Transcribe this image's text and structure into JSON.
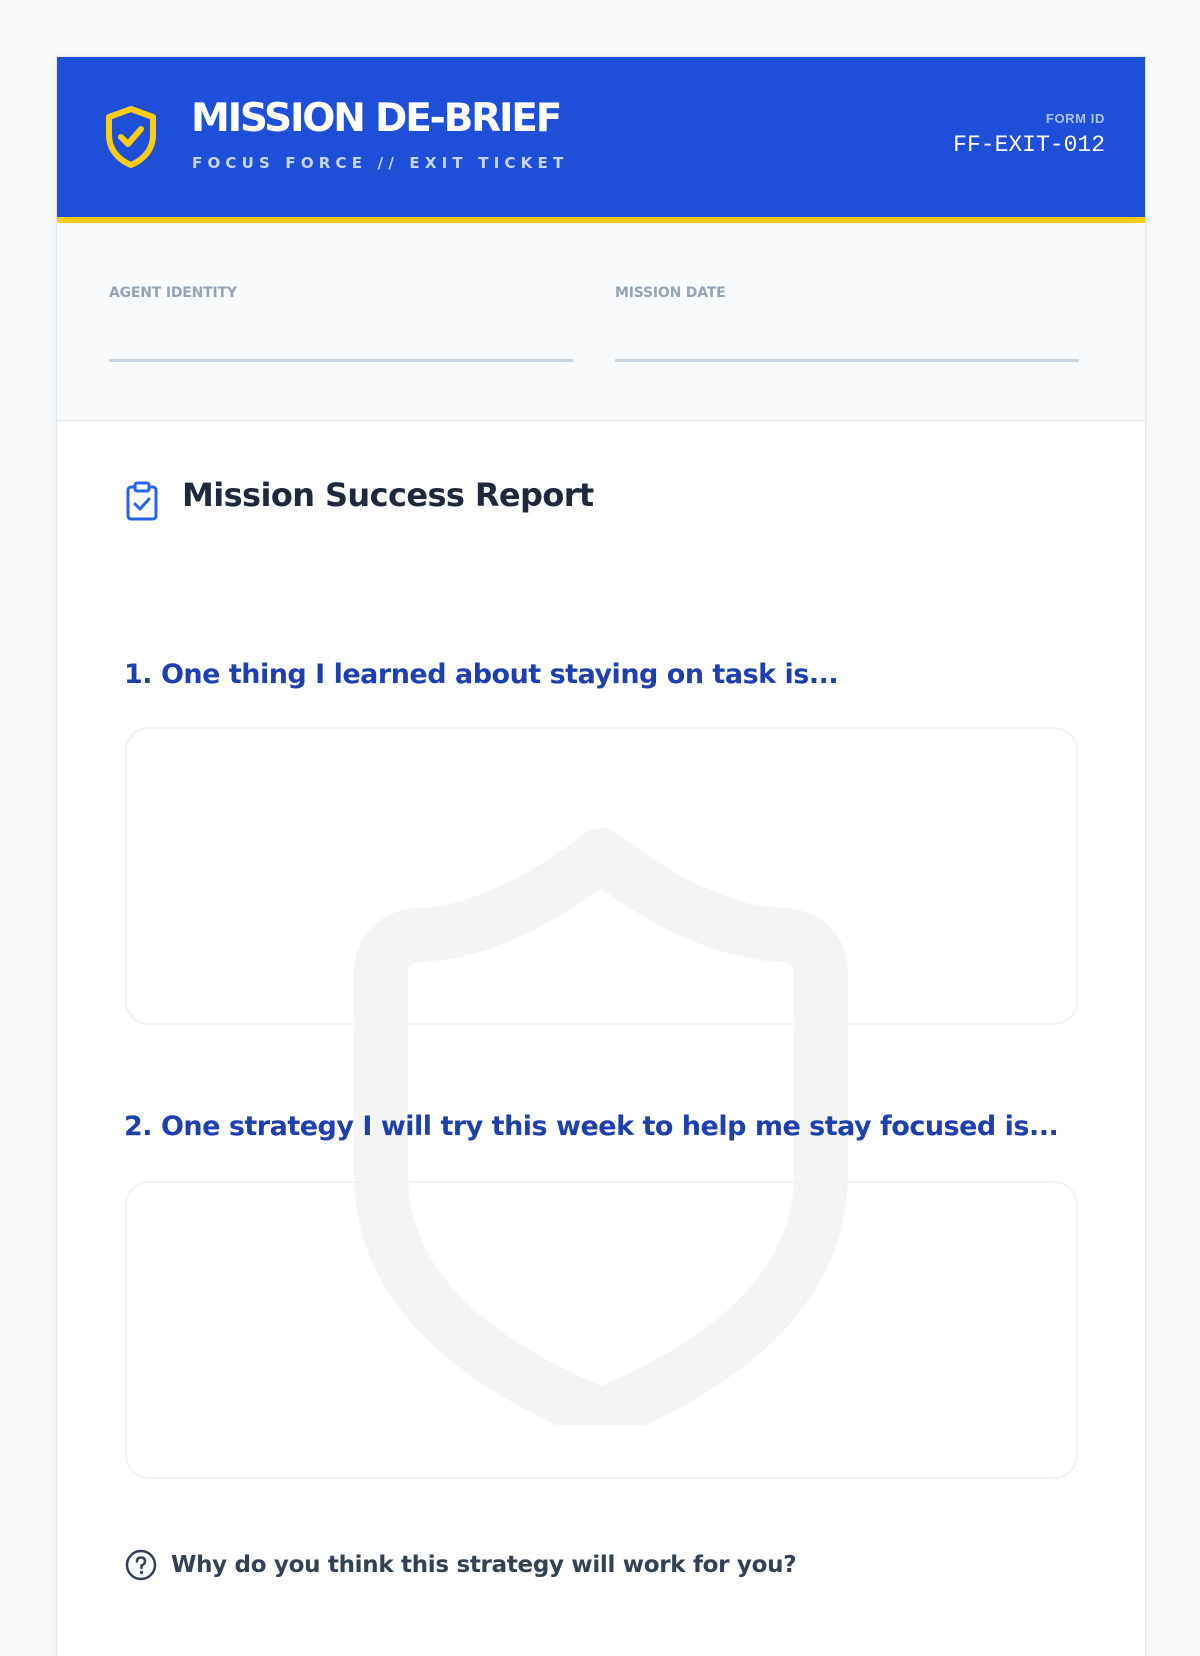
{
  "header": {
    "title": "MISSION DE-BRIEF",
    "subtitle": "FOCUS FORCE // EXIT TICKET",
    "form_id_label": "FORM ID",
    "form_id_value": "FF-EXIT-012"
  },
  "meta": {
    "agent_label": "AGENT IDENTITY",
    "agent_value": "",
    "date_label": "MISSION DATE",
    "date_value": ""
  },
  "section": {
    "title": "Mission Success Report",
    "questions": [
      {
        "prompt": "1. One thing I learned about staying on task is...",
        "answer": ""
      },
      {
        "prompt": "2. One strategy I will try this week to help me stay focused is...",
        "answer": ""
      }
    ],
    "followup": "Why do you think this strategy will work for you?"
  },
  "colors": {
    "header_bg": "#1e4fd8",
    "accent_yellow": "#facc15",
    "question_blue": "#1e40af",
    "title_dark": "#1e293b",
    "label_gray": "#94a3b8"
  },
  "icons": {
    "header": "shield-check-icon",
    "section": "clipboard-check-icon",
    "followup": "help-circle-icon",
    "watermark": "shield-watermark-icon"
  }
}
